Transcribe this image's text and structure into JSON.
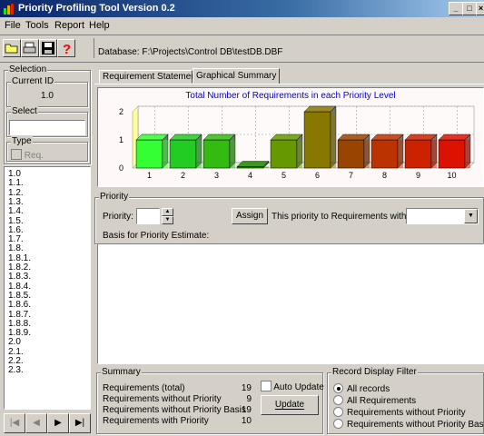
{
  "window": {
    "title": "Priority Profiling Tool Version 0.2",
    "min": "_",
    "max": "□",
    "close": "×"
  },
  "menu": [
    "File",
    "Tools",
    "Report",
    "Help"
  ],
  "database_label": "Database: F:\\Projects\\Control DB\\testDB.DBF",
  "left": {
    "selection_label": "Selection",
    "current_id_label": "Current ID",
    "current_id": "1.0",
    "select_label": "Select",
    "type_label": "Type",
    "req_label": "Req.",
    "tree": [
      "1.0",
      "1.1.",
      "1.2.",
      "1.3.",
      "1.4.",
      "1.5.",
      "1.6.",
      "1.7.",
      "1.8.",
      "1.8.1.",
      "1.8.2.",
      "1.8.3.",
      "1.8.4.",
      "1.8.5.",
      "1.8.6.",
      "1.8.7.",
      "1.8.8.",
      "1.8.9.",
      "2.0",
      "2.1.",
      "2.2.",
      "2.3."
    ]
  },
  "tabs": [
    "Requirement Statement",
    "Graphical Summary"
  ],
  "chart_data": {
    "type": "bar",
    "title": "Total Number of Requirements in each Priority Level",
    "categories": [
      "1",
      "2",
      "3",
      "4",
      "5",
      "6",
      "7",
      "8",
      "9",
      "10"
    ],
    "values": [
      1,
      1,
      1,
      0,
      1,
      2,
      1,
      1,
      1,
      1
    ],
    "ylim": [
      0,
      2
    ],
    "yticks": [
      "0",
      "1",
      "2"
    ],
    "colors": [
      "#33ff33",
      "#22cc22",
      "#33bb11",
      "#228800",
      "#669900",
      "#887700",
      "#994400",
      "#bb3300",
      "#cc2200",
      "#dd1100"
    ]
  },
  "priority": {
    "group_label": "Priority",
    "priority_label": "Priority:",
    "assign_button": "Assign",
    "keyword_label": "This priority to Requirements with Keyword:",
    "basis_label": "Basis for Priority Estimate:"
  },
  "summary": {
    "group_label": "Summary",
    "rows": [
      {
        "label": "Requirements (total)",
        "value": "19"
      },
      {
        "label": "Requirements without Priority",
        "value": "9"
      },
      {
        "label": "Requirements without Priority Basis",
        "value": "19"
      },
      {
        "label": "Requirements with  Priority",
        "value": "10"
      }
    ],
    "auto_update_label": "Auto Update",
    "update_button": "Update"
  },
  "filter": {
    "group_label": "Record Display Filter",
    "options": [
      "All records",
      "All Requirements",
      "Requirements without Priority",
      "Requirements without Priority Basis"
    ],
    "selected_index": 0
  }
}
